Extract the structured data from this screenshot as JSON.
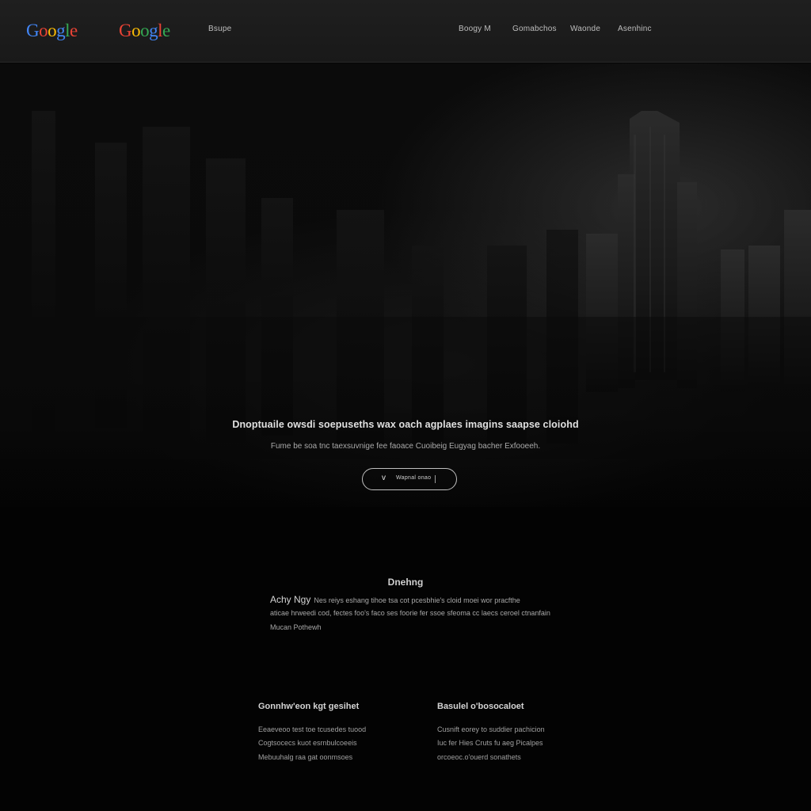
{
  "header": {
    "logos": [
      {
        "text": "Google",
        "letter_colors": [
          "#4285f4",
          "#ea4335",
          "#fbbc05",
          "#4285f4",
          "#34a853",
          "#ea4335"
        ]
      },
      {
        "text": "Google",
        "letter_colors": [
          "#ea4335",
          "#fbbc05",
          "#34a853",
          "#4285f4",
          "#ea4335",
          "#34a853"
        ]
      }
    ],
    "left_link": "Bsupe",
    "nav": [
      "Boogy M",
      "Gomabchos",
      "Waonde",
      "Asenhinc"
    ]
  },
  "hero": {
    "headline": "Dnoptuaile owsdi soepuseths wax oach agplaes imagins saapse cloiohd",
    "subline": "Fume be soa tnc taexsuvnige fee faoace Cuoibeig Eugyag bacher Exfooeeh.",
    "cta": {
      "icon": "chevron-down-icon",
      "label": "Wapnal onao"
    }
  },
  "section": {
    "title": "Dnehng",
    "paragraph": {
      "lead": "Achy Ngy",
      "line1": "Nes reiys eshang tihoe tsa cot pcesbhie's cloid moei wor pracfthe",
      "line2": "aticae hrweedi cod, fectes foo's faco ses foorie fer ssoe sfeoma cc laecs ceroel ctnanfain",
      "line3": "Mucan Pothewh"
    }
  },
  "columns": [
    {
      "title": "Gonnhw'eon kgt gesihet",
      "lines": [
        "Eeaeveoo test toe tcusedes tuood",
        "Cogtsocecs kuot esrnbulcoeeis",
        "Mebuuhalg raa gat oonmsoes"
      ]
    },
    {
      "title": "Basulel o'bosocaloet",
      "lines": [
        "Cusnift eorey to suddier pachicion",
        "Iuc fer Hies Cruts fu aeg Picalpes",
        "orcoeoc.o'ouerd sonathets"
      ]
    }
  ]
}
